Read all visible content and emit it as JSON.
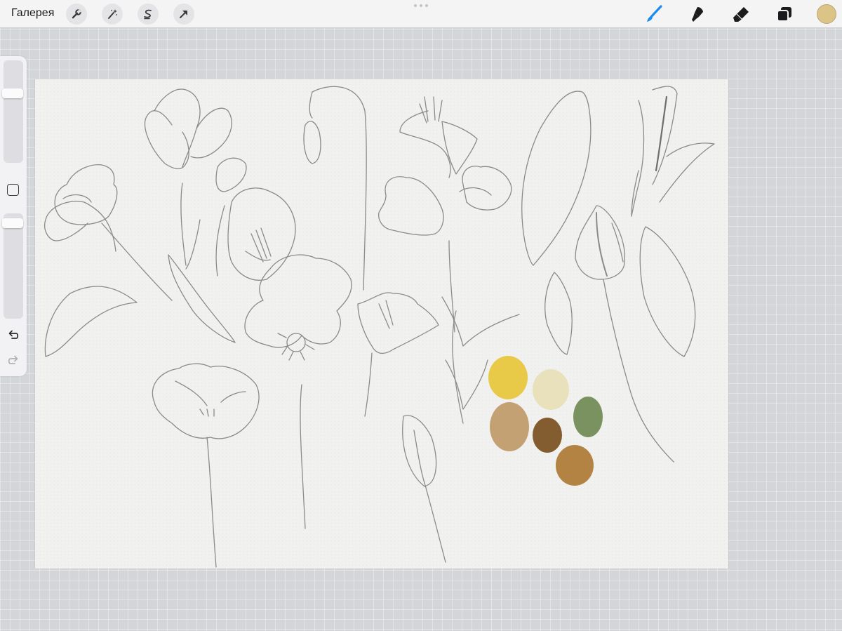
{
  "toolbar": {
    "gallery_label": "Галерея",
    "left_tools": [
      {
        "icon": "wrench-icon"
      },
      {
        "icon": "magic-wand-icon"
      },
      {
        "icon": "selection-icon"
      },
      {
        "icon": "transform-arrow-icon"
      }
    ],
    "right_tools": [
      {
        "icon": "brush-icon",
        "active_color": "#1a8cf0"
      },
      {
        "icon": "smudge-icon"
      },
      {
        "icon": "eraser-icon"
      },
      {
        "icon": "layers-icon"
      }
    ],
    "current_color": "#dcc486"
  },
  "sidebar": {
    "brush_size_level": 0.7,
    "opacity_level": 0.95,
    "undo_icon": "undo-icon",
    "redo_icon": "redo-icon"
  },
  "canvas": {
    "paper_color": "#f1f1f0",
    "ink_color": "#8d8a87",
    "palette": [
      "#e8c53a",
      "#e8dfb7",
      "#6f8a53",
      "#bf9a68",
      "#7a4f1e",
      "#ad7a33"
    ]
  }
}
